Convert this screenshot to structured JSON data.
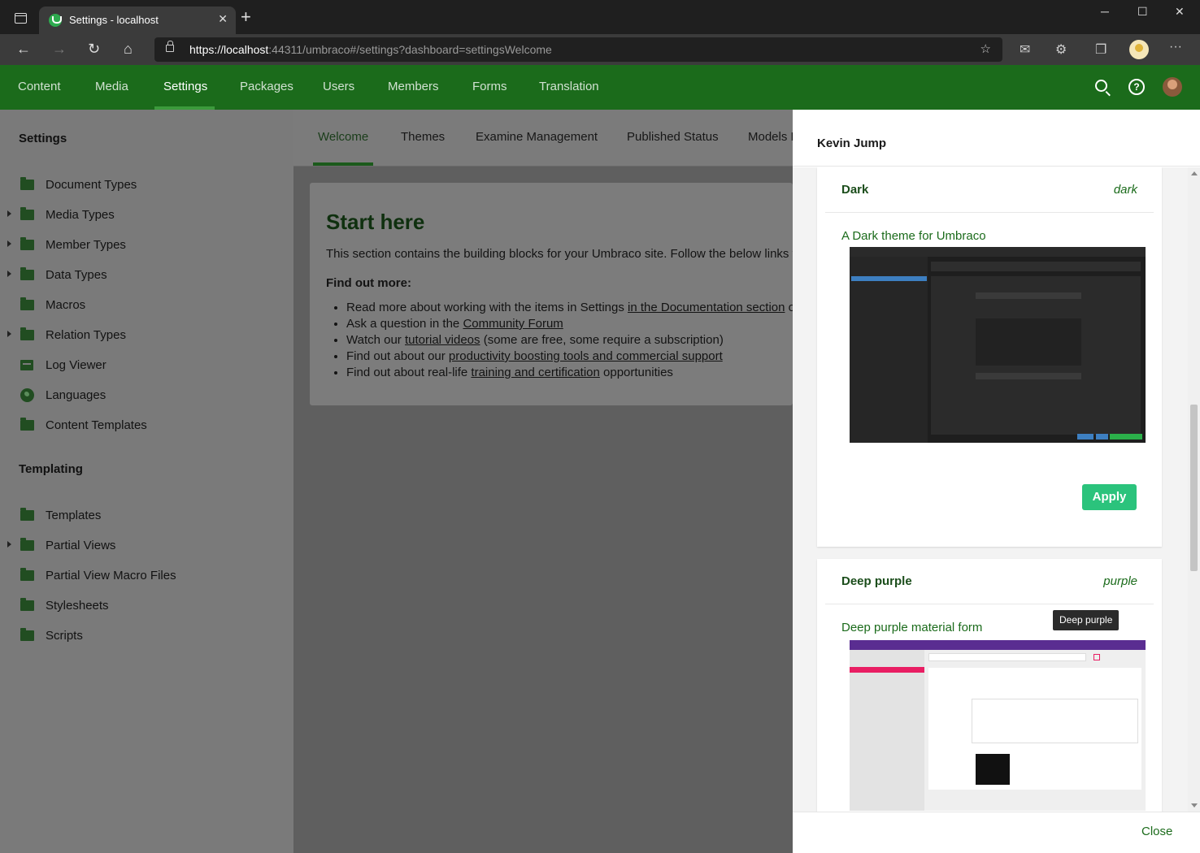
{
  "browser": {
    "tab_title": "Settings - localhost",
    "url_host": "https://localhost",
    "url_rest": ":44311/umbraco#/settings?dashboard=settingsWelcome",
    "controls": {
      "minimize": "─",
      "maximize": "☐",
      "close": "✕",
      "new_tab": "+",
      "close_tab": "✕"
    },
    "nav": {
      "back": "←",
      "forward": "→",
      "reload": "↻",
      "home": "⌂",
      "menu": "···"
    }
  },
  "header": {
    "sections": [
      "Content",
      "Media",
      "Settings",
      "Packages",
      "Users",
      "Members",
      "Forms",
      "Translation"
    ],
    "active_section": "Settings",
    "help": "?"
  },
  "sidebar": {
    "settings_heading": "Settings",
    "settings_items": [
      {
        "label": "Document Types",
        "icon": "folder-icon",
        "expandable": false
      },
      {
        "label": "Media Types",
        "icon": "folder-icon",
        "expandable": true
      },
      {
        "label": "Member Types",
        "icon": "folder-icon",
        "expandable": true
      },
      {
        "label": "Data Types",
        "icon": "folder-icon",
        "expandable": true
      },
      {
        "label": "Macros",
        "icon": "folder-icon",
        "expandable": false
      },
      {
        "label": "Relation Types",
        "icon": "folder-icon",
        "expandable": true
      },
      {
        "label": "Log Viewer",
        "icon": "log-viewer-icon",
        "expandable": false
      },
      {
        "label": "Languages",
        "icon": "globe-icon",
        "expandable": false
      },
      {
        "label": "Content Templates",
        "icon": "folder-icon",
        "expandable": false
      }
    ],
    "templating_heading": "Templating",
    "templating_items": [
      {
        "label": "Templates",
        "icon": "folder-icon",
        "expandable": false
      },
      {
        "label": "Partial Views",
        "icon": "folder-icon",
        "expandable": true
      },
      {
        "label": "Partial View Macro Files",
        "icon": "folder-icon",
        "expandable": false
      },
      {
        "label": "Stylesheets",
        "icon": "folder-icon",
        "expandable": false
      },
      {
        "label": "Scripts",
        "icon": "folder-icon",
        "expandable": false
      }
    ]
  },
  "dashboard": {
    "tabs": [
      "Welcome",
      "Themes",
      "Examine Management",
      "Published Status",
      "Models Builder"
    ],
    "active_tab": "Welcome",
    "title": "Start here",
    "intro": "This section contains the building blocks for your Umbraco site. Follow the below links to find out more about working with the items in the Settings section:",
    "find_out_more": "Find out more:",
    "links": [
      {
        "before": "Read more about working with the items in Settings ",
        "link": "in the Documentation section",
        "after": " of Our Umbraco"
      },
      {
        "before": "Ask a question in the ",
        "link": "Community Forum",
        "after": ""
      },
      {
        "before": "Watch our ",
        "link": "tutorial videos",
        "after": " (some are free, some require a subscription)"
      },
      {
        "before": "Find out about our ",
        "link": "productivity boosting tools and commercial support",
        "after": ""
      },
      {
        "before": "Find out about real-life ",
        "link": "training and certification",
        "after": " opportunities"
      }
    ]
  },
  "panel": {
    "title": "Kevin Jump",
    "themes": [
      {
        "name": "Dark",
        "alias": "dark",
        "description": "A Dark theme for Umbraco",
        "apply_label": "Apply"
      },
      {
        "name": "Deep purple",
        "alias": "purple",
        "description": "Deep purple material form"
      }
    ],
    "tooltip": "Deep purple",
    "close_label": "Close"
  },
  "colors": {
    "header_green": "#1b6b1b",
    "apply_green": "#2bc37c",
    "purple_bar": "#5a2d91",
    "pink_accent": "#e91e63"
  }
}
